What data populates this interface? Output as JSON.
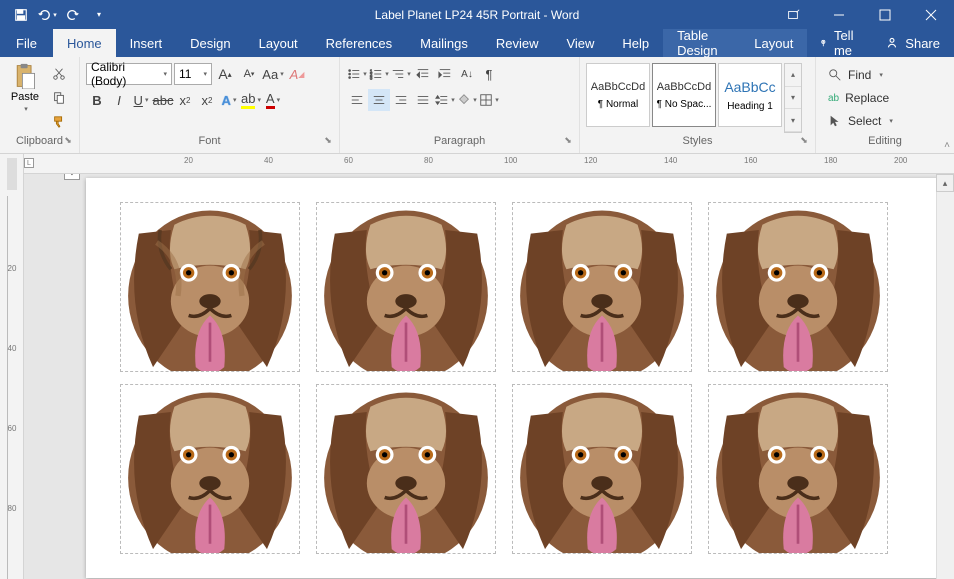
{
  "titlebar": {
    "doc_title": "Label Planet LP24 45R Portrait  -  Word"
  },
  "tabs": {
    "file": "File",
    "home": "Home",
    "insert": "Insert",
    "design": "Design",
    "layout": "Layout",
    "references": "References",
    "mailings": "Mailings",
    "review": "Review",
    "view": "View",
    "help": "Help",
    "table_design": "Table Design",
    "table_layout": "Layout",
    "tellme": "Tell me",
    "share": "Share"
  },
  "ribbon": {
    "clipboard": {
      "paste": "Paste",
      "label": "Clipboard"
    },
    "font": {
      "name": "Calibri (Body)",
      "size": "11",
      "label": "Font"
    },
    "paragraph": {
      "label": "Paragraph"
    },
    "styles": {
      "label": "Styles",
      "items": [
        {
          "sample": "AaBbCcDd",
          "name": "¶ Normal"
        },
        {
          "sample": "AaBbCcDd",
          "name": "¶ No Spac..."
        },
        {
          "sample": "AaBbCc",
          "name": "Heading 1"
        }
      ]
    },
    "editing": {
      "find": "Find",
      "replace": "Replace",
      "select": "Select",
      "label": "Editing"
    }
  },
  "hruler_ticks": [
    "20",
    "40",
    "60",
    "80",
    "100",
    "120",
    "140",
    "160",
    "180",
    "200"
  ],
  "vruler_ticks": [
    "20",
    "40",
    "60",
    "80"
  ]
}
